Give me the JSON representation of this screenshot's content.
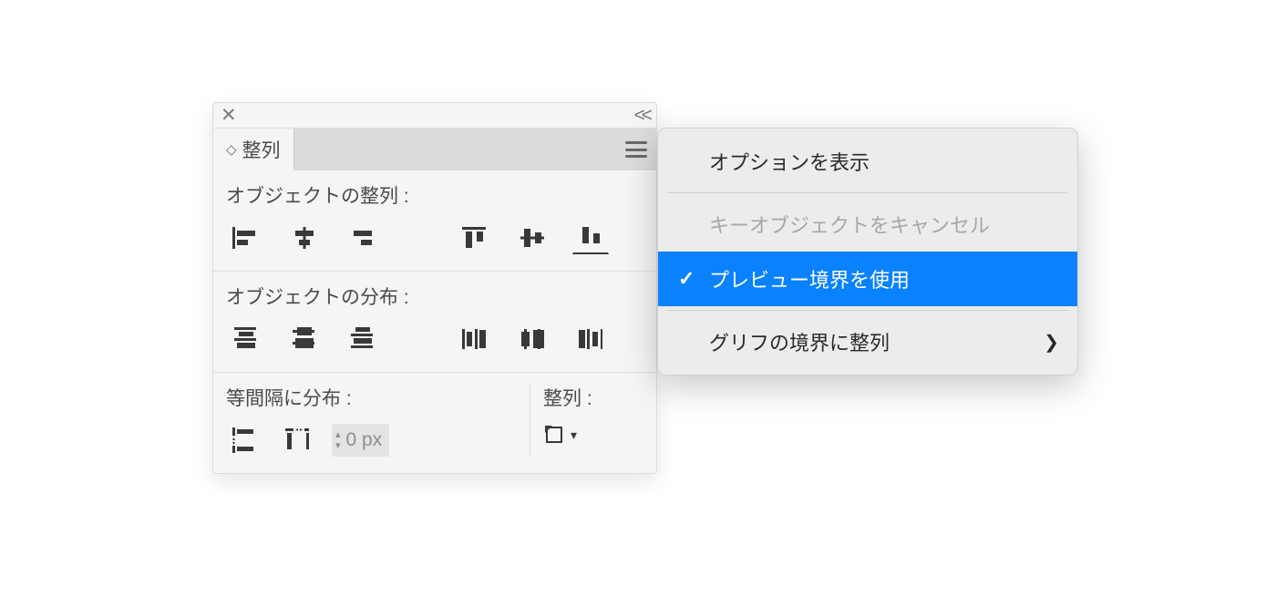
{
  "panel": {
    "tab_label": "整列",
    "section_align_label": "オブジェクトの整列 :",
    "section_distribute_label": "オブジェクトの分布 :",
    "section_spacing_label": "等間隔に分布 :",
    "section_alignto_label": "整列 :",
    "px_value": "0 px"
  },
  "flyout": {
    "items": [
      {
        "label": "オプションを表示",
        "disabled": false,
        "selected": false,
        "submenu": false
      },
      {
        "label": "キーオブジェクトをキャンセル",
        "disabled": true,
        "selected": false,
        "submenu": false
      },
      {
        "label": "プレビュー境界を使用",
        "disabled": false,
        "selected": true,
        "submenu": false
      },
      {
        "label": "グリフの境界に整列",
        "disabled": false,
        "selected": false,
        "submenu": true
      }
    ]
  }
}
